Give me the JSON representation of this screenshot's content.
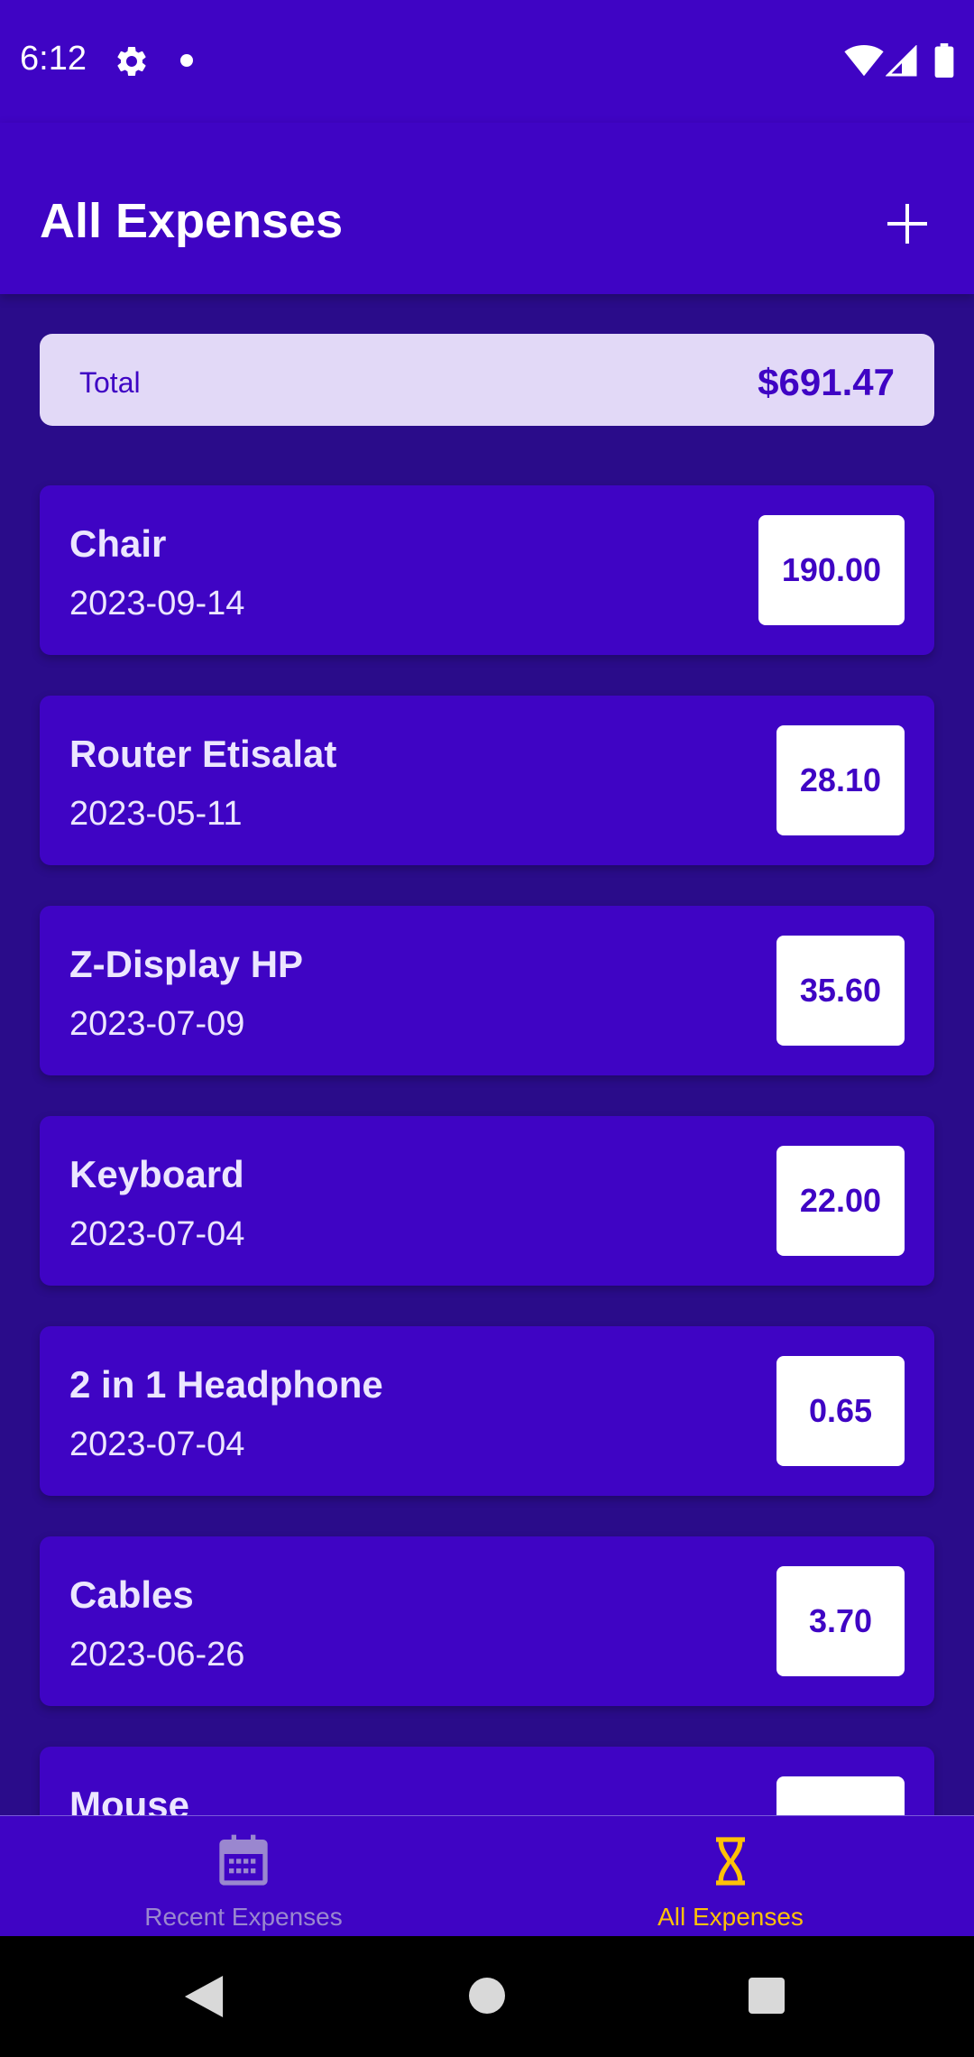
{
  "status_bar": {
    "time": "6:12",
    "icons": [
      "gear-icon",
      "notification-dot-icon",
      "wifi-icon",
      "signal-icon",
      "battery-icon"
    ]
  },
  "app_bar": {
    "title": "All Expenses",
    "add_icon": "plus-icon"
  },
  "summary": {
    "label": "Total",
    "value": "$691.47"
  },
  "expenses": [
    {
      "title": "Chair",
      "date": "2023-09-14",
      "amount": "190.00"
    },
    {
      "title": "Router Etisalat",
      "date": "2023-05-11",
      "amount": "28.10"
    },
    {
      "title": "Z-Display HP",
      "date": "2023-07-09",
      "amount": "35.60"
    },
    {
      "title": "Keyboard",
      "date": "2023-07-04",
      "amount": "22.00"
    },
    {
      "title": "2 in 1 Headphone",
      "date": "2023-07-04",
      "amount": "0.65"
    },
    {
      "title": "Cables",
      "date": "2023-06-26",
      "amount": "3.70"
    },
    {
      "title": "Mouse",
      "date": "",
      "amount": ""
    }
  ],
  "bottom_nav": {
    "items": [
      {
        "label": "Recent Expenses",
        "icon": "calendar-icon",
        "active": false
      },
      {
        "label": "All Expenses",
        "icon": "hourglass-icon",
        "active": true
      }
    ]
  },
  "colors": {
    "primary": "#3f04c4",
    "background": "#2a0c8a",
    "summary_background": "#e2d9f7",
    "active_tab": "#ffc107",
    "inactive_tab": "#9a87cf"
  }
}
